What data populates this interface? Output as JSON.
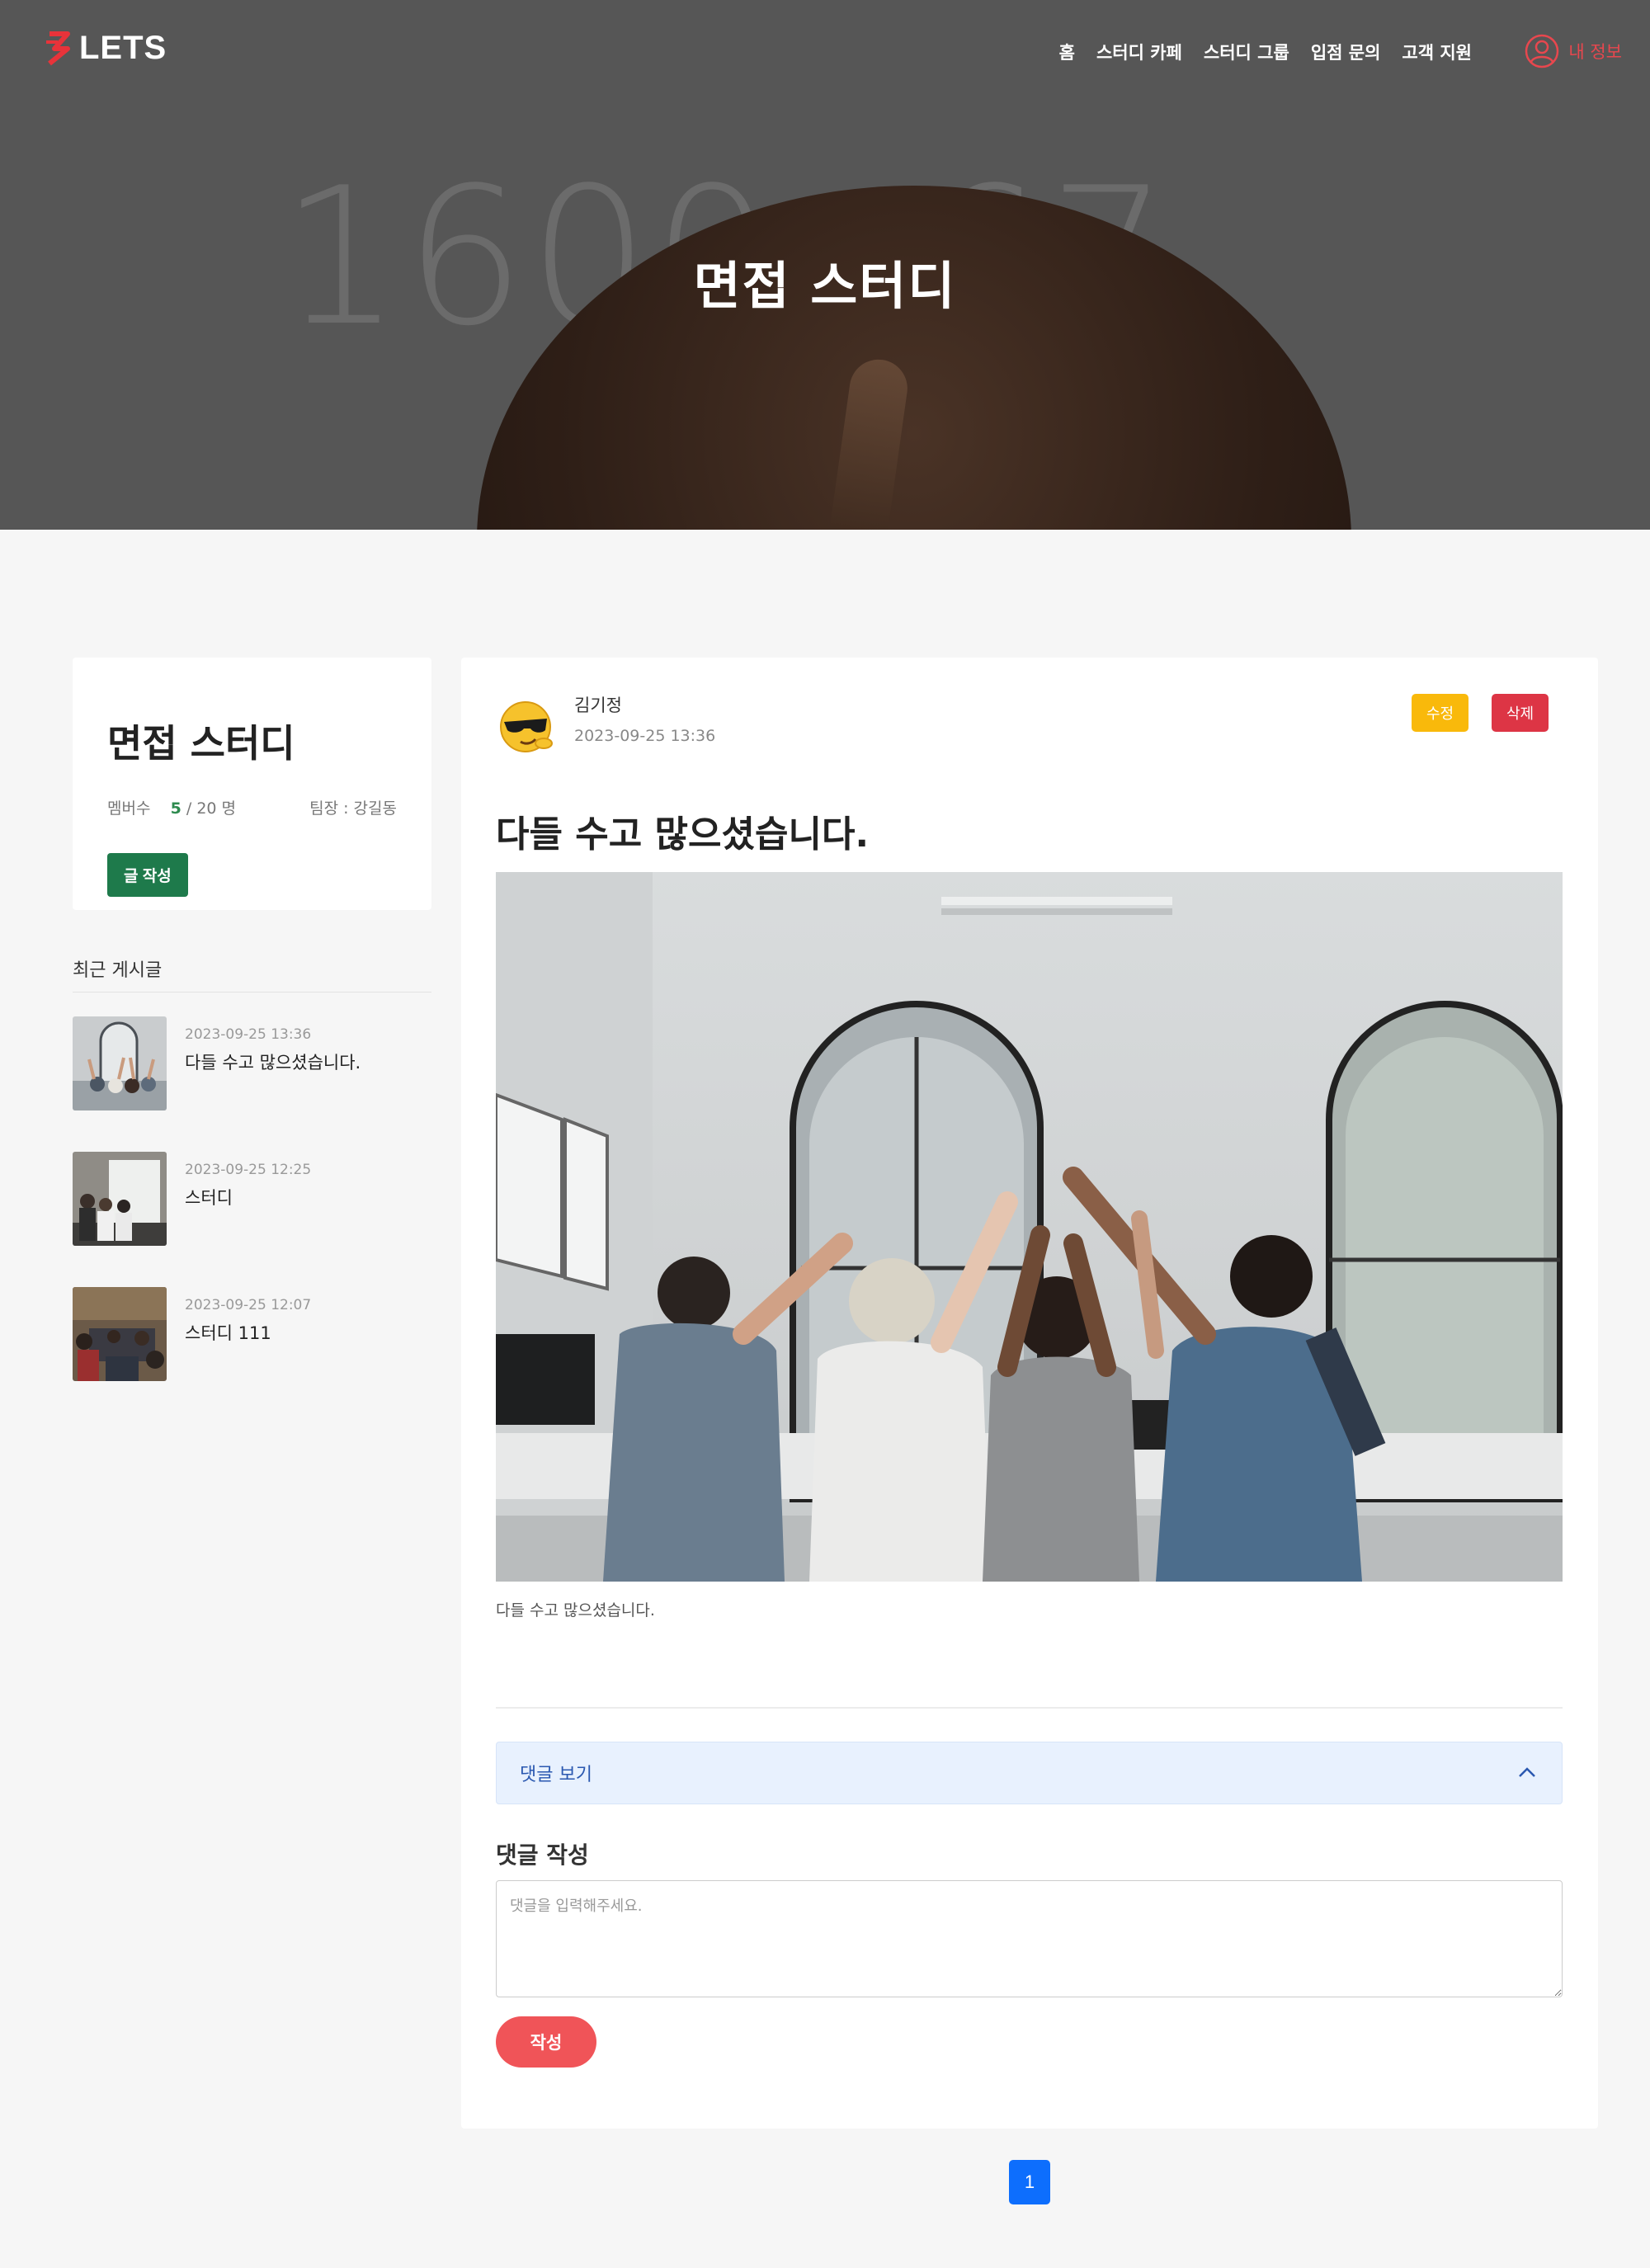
{
  "header": {
    "logo_text": "LETS",
    "nav": [
      "홈",
      "스터디 카페",
      "스터디 그룹",
      "입점 문의",
      "고객 지원"
    ],
    "my_info": "내 정보",
    "hero_title": "면접 스터디",
    "hero_bg_left": "1600",
    "hero_bg_right": "67"
  },
  "sidebar": {
    "study_name": "면접 스터디",
    "members_label": "멤버수",
    "members_current": "5",
    "members_total": " / 20 명",
    "leader": "팀장 : 강길동",
    "write_button": "글 작성",
    "recent_title": "최근 게시글",
    "recent_posts": [
      {
        "date": "2023-09-25 13:36",
        "title": "다들 수고 많으셨습니다."
      },
      {
        "date": "2023-09-25 12:25",
        "title": "스터디"
      },
      {
        "date": "2023-09-25 12:07",
        "title": "스터디 111"
      }
    ]
  },
  "post": {
    "author": "김기정",
    "date": "2023-09-25 13:36",
    "edit_button": "수정",
    "delete_button": "삭제",
    "title": "다들 수고 많으셨습니다.",
    "caption": "다들 수고 많으셨습니다.",
    "comment_toggle": "댓글 보기",
    "comment_label": "댓글 작성",
    "comment_placeholder": "댓글을 입력해주세요.",
    "submit_button": "작성"
  },
  "pagination": {
    "current": "1"
  },
  "colors": {
    "brand": "#e8474e",
    "write_green": "#1e7a4b",
    "edit_yellow": "#f9b90b",
    "delete_red": "#dd3545",
    "submit_red": "#f05458",
    "page_blue": "#0d6efd"
  }
}
